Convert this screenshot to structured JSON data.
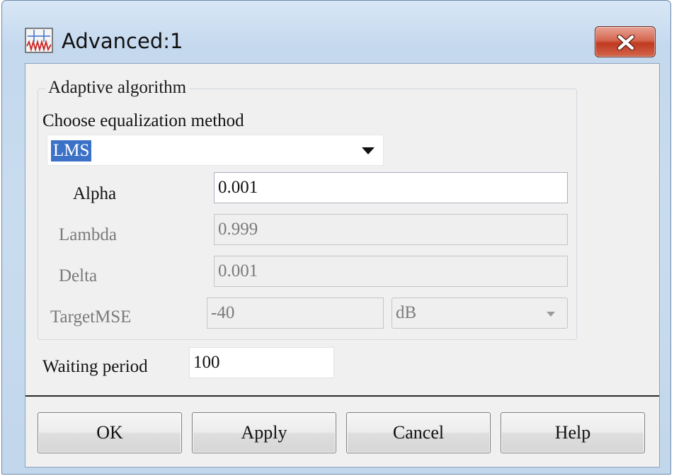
{
  "window": {
    "title": "Advanced:1",
    "icon": "waveform-icon",
    "close_icon": "close-icon",
    "close_color": "#c63b22"
  },
  "group": {
    "legend": "Adaptive algorithm",
    "method_label": "Choose equalization method",
    "method_value": "LMS",
    "fields": {
      "alpha": {
        "label": "Alpha",
        "value": "0.001",
        "enabled": true
      },
      "lambda": {
        "label": "Lambda",
        "value": "0.999",
        "enabled": false
      },
      "delta": {
        "label": "Delta",
        "value": "0.001",
        "enabled": false
      },
      "target_mse": {
        "label": "TargetMSE",
        "value": "-40",
        "unit": "dB",
        "enabled": false
      }
    }
  },
  "waiting_period": {
    "label": "Waiting period",
    "value": "100"
  },
  "buttons": {
    "ok": "OK",
    "apply": "Apply",
    "cancel": "Cancel",
    "help": "Help"
  },
  "colors": {
    "selection": "#3b72c8",
    "frame": "#c4d8ee",
    "dialog_background": "#f0f0f0"
  }
}
